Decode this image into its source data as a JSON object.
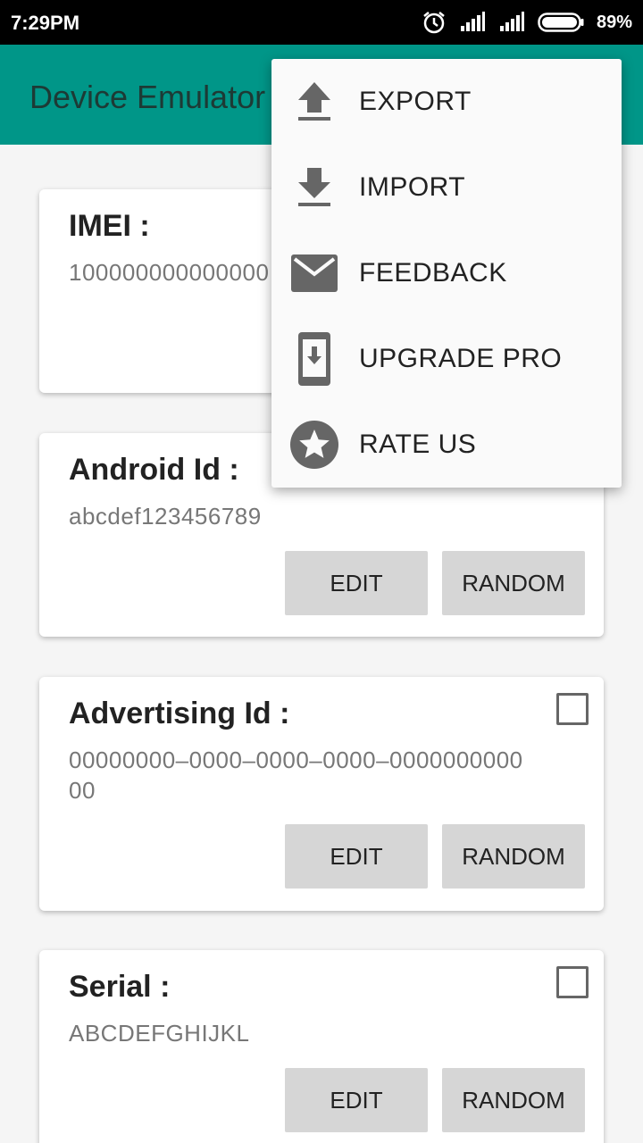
{
  "status_bar": {
    "time": "7:29PM",
    "battery_percent": "89%",
    "icons": [
      "alarm-icon",
      "signal-icon",
      "signal-icon",
      "battery-icon"
    ]
  },
  "app_bar": {
    "title": "Device Emulator",
    "background": "#009688"
  },
  "cards": [
    {
      "label": "IMEI :",
      "value": "100000000000000",
      "checkbox_checked": false
    },
    {
      "label": "Android Id :",
      "value": "abcdef123456789",
      "checkbox_checked": false,
      "edit_label": "EDIT",
      "random_label": "RANDOM"
    },
    {
      "label": "Advertising Id :",
      "value_line1": "00000000–0000–0000–0000–0000000000",
      "value_line2": "00",
      "checkbox_checked": false,
      "edit_label": "EDIT",
      "random_label": "RANDOM"
    },
    {
      "label": "Serial :",
      "value": "ABCDEFGHIJKL",
      "checkbox_checked": false,
      "edit_label": "EDIT",
      "random_label": "RANDOM"
    }
  ],
  "menu": {
    "items": [
      {
        "label": "EXPORT",
        "icon": "upload-icon"
      },
      {
        "label": "IMPORT",
        "icon": "download-icon"
      },
      {
        "label": "FEEDBACK",
        "icon": "mail-icon"
      },
      {
        "label": "UPGRADE PRO",
        "icon": "phone-download-icon"
      },
      {
        "label": "RATE US",
        "icon": "star-circle-icon"
      }
    ]
  },
  "colors": {
    "accent": "#009688",
    "button": "#d6d6d6",
    "icon": "#666666"
  }
}
